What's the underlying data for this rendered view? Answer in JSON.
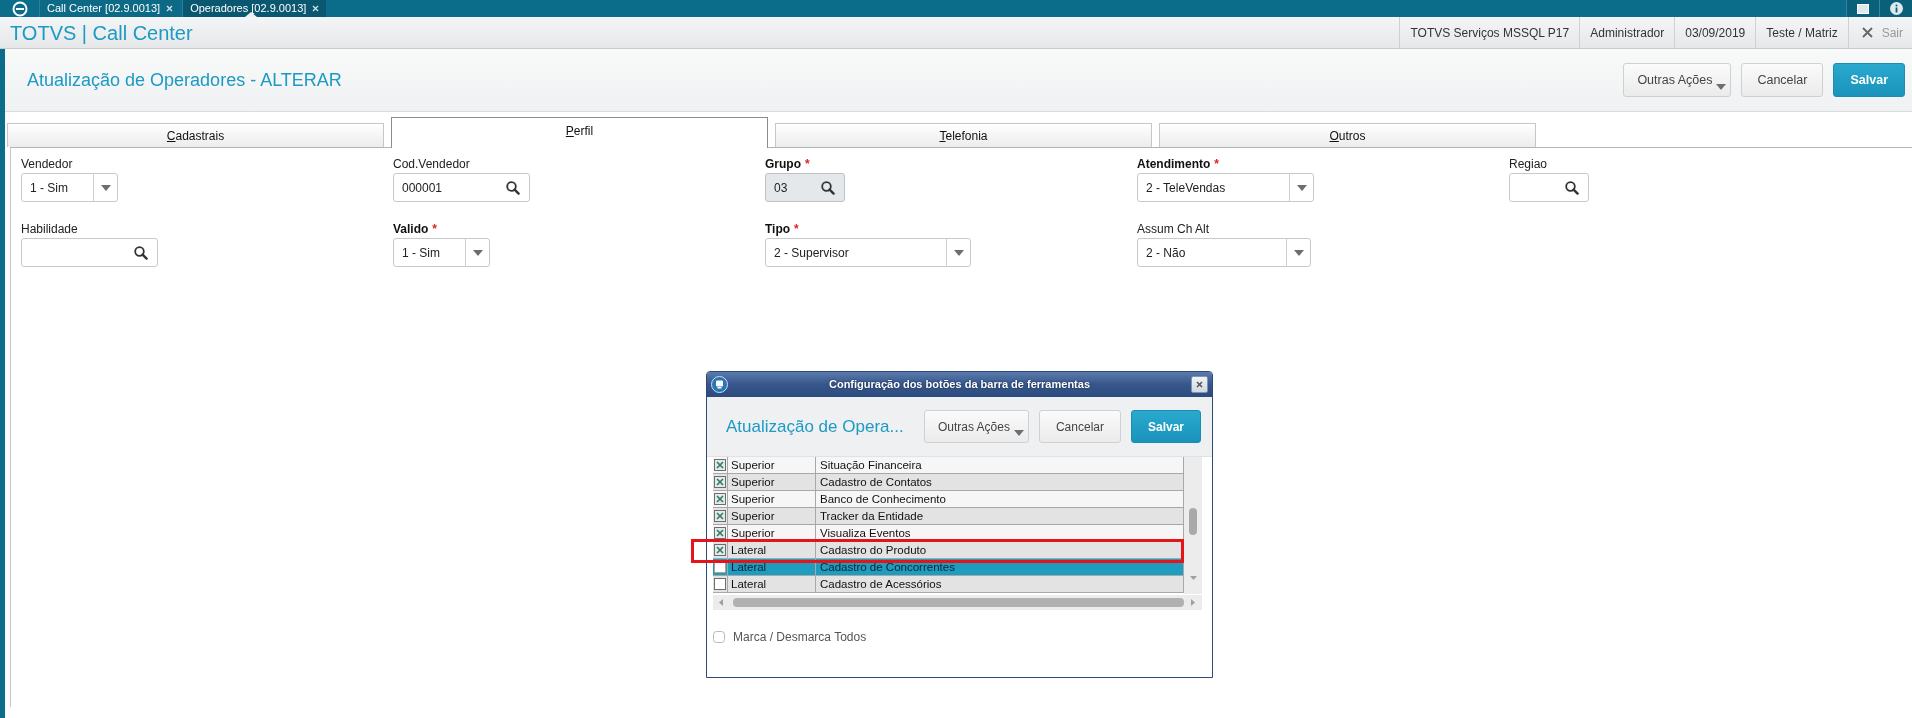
{
  "browser_tabs": [
    {
      "label": "Call Center [02.9.0013]",
      "selected": false
    },
    {
      "label": "Operadores [02.9.0013]",
      "selected": true
    }
  ],
  "app_header": {
    "title": "TOTVS | Call Center",
    "info": [
      "TOTVS Serviços MSSQL P17",
      "Administrador",
      "03/09/2019",
      "Teste / Matriz"
    ],
    "exit_label": "Sair"
  },
  "page_header": {
    "title": "Atualização de Operadores - ALTERAR",
    "buttons": [
      {
        "label": "Outras Ações",
        "kind": "menu"
      },
      {
        "label": "Cancelar",
        "kind": "secondary"
      },
      {
        "label": "Salvar",
        "kind": "primary"
      }
    ]
  },
  "form_tabs": [
    {
      "label": "Cadastrais",
      "selected": false
    },
    {
      "label": "Perfil",
      "selected": true
    },
    {
      "label": "Telefonia",
      "selected": false
    },
    {
      "label": "Outros",
      "selected": false
    }
  ],
  "field_rows": [
    [
      {
        "label": "Vendedor",
        "required": false,
        "kind": "select",
        "value": "1 - Sim",
        "disabled": false
      },
      {
        "label": "Cod.Vendedor",
        "required": false,
        "kind": "lookup",
        "value": "000001",
        "disabled": false
      },
      {
        "label": "Grupo",
        "required": true,
        "required_mark": "*",
        "kind": "lookup",
        "value": "03",
        "disabled": true
      },
      {
        "label": "Atendimento",
        "required": true,
        "required_mark": "*",
        "kind": "select",
        "value": "2 - TeleVendas",
        "disabled": false
      },
      {
        "label": "Regiao",
        "required": false,
        "kind": "lookup",
        "disabled": false
      }
    ],
    [
      {
        "label": "Habilidade",
        "required": false,
        "kind": "lookup",
        "disabled": false
      },
      {
        "label": "Valido",
        "required": true,
        "required_mark": "*",
        "kind": "select",
        "value": "1 - Sim",
        "disabled": false
      },
      {
        "label": "Tipo",
        "required": true,
        "required_mark": "*",
        "kind": "select",
        "value": "2 - Supervisor",
        "disabled": false
      },
      {
        "label": "Assum Ch Alt",
        "required": false,
        "kind": "select",
        "value": "2 - Não",
        "disabled": false
      }
    ]
  ],
  "dialog": {
    "title": "Configuração dos botões da barra de ferramentas",
    "heading": "Atualização de Opera...",
    "buttons": [
      {
        "label": "Outras Ações",
        "kind": "menu"
      },
      {
        "label": "Cancelar",
        "kind": "secondary"
      },
      {
        "label": "Salvar",
        "kind": "primary"
      }
    ],
    "rows": [
      {
        "checked": true,
        "cells": [
          "Superior",
          "Situação Financeira"
        ],
        "selected": false,
        "highlighted": false
      },
      {
        "checked": true,
        "cells": [
          "Superior",
          "Cadastro de Contatos"
        ],
        "selected": false,
        "highlighted": false
      },
      {
        "checked": true,
        "cells": [
          "Superior",
          "Banco de Conhecimento"
        ],
        "selected": false,
        "highlighted": false
      },
      {
        "checked": true,
        "cells": [
          "Superior",
          "Tracker da Entidade"
        ],
        "selected": false,
        "highlighted": false
      },
      {
        "checked": true,
        "cells": [
          "Superior",
          "Visualiza Eventos"
        ],
        "selected": false,
        "highlighted": false
      },
      {
        "checked": true,
        "cells": [
          "Lateral",
          "Cadastro do Produto"
        ],
        "selected": false,
        "highlighted": true
      },
      {
        "checked": false,
        "cells": [
          "Lateral",
          "Cadastro de Concorrentes"
        ],
        "selected": true,
        "highlighted": false
      },
      {
        "checked": false,
        "cells": [
          "Lateral",
          "Cadastro de Acessórios"
        ],
        "selected": false,
        "highlighted": false
      }
    ],
    "select_all": {
      "label": "Marca / Desmarca Todos",
      "checked": false
    }
  }
}
